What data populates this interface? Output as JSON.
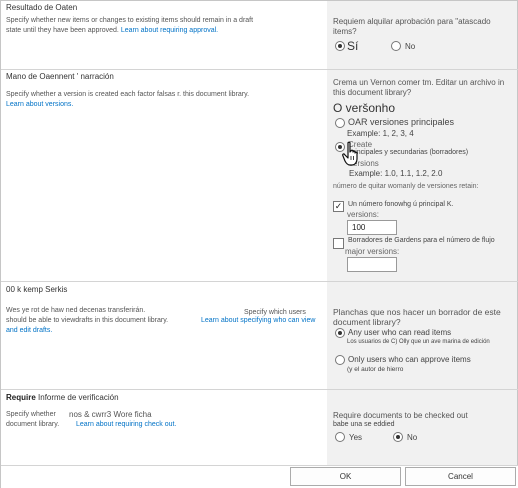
{
  "s1": {
    "title": "Resultado de Oaten",
    "desc": "Specify whether new items or changes to existing items should remain in a draft state until they have been approved.",
    "link": "Learn about requiring approval.",
    "question": "Requiem alquilar aprobación para \"atascado items?",
    "opt_yes": "Sí",
    "opt_no": "No"
  },
  "s2": {
    "title": "Mano de Oaennent ' narración",
    "desc": "Specify whether a version is created each factor falsas r.          this document library.",
    "link": "Learn about versions.",
    "question": "Crema un Vernon comer tm. Editar un archivo in this document library?",
    "heading": "O veršonho",
    "opt1": "OAR versiones principales",
    "opt1_example": "Example: 1, 2, 3, 4",
    "opt2_line1": "Create",
    "opt2_line2": "principales y secundarias (borradores)",
    "opt2_line3": "versions",
    "opt2_example": "Example: 1.0, 1.1, 1.2, 2.0",
    "limit_label": "número de quitar womanly de versiones retain:",
    "major_check_label": "Un número fonowhg ú principal K.",
    "major_check_label2": "versions:",
    "major_value": "100",
    "drafts_check_label": "Borradores de Gardens para el número de flujo",
    "drafts_check_label2": "major versions:"
  },
  "s3": {
    "title": "00 k kemp Serkis",
    "desc_line1": "Wes ye rot de haw ned decenas transferirán.",
    "desc_mid": "Specify which users",
    "desc_line2": "should be able to viewdrafts in this document library.",
    "link": "Learn about specifying who can view and edit drafts.",
    "question": "Planchas que nos hacer un borrador de este document library?",
    "opt1": "Any user who can read items",
    "opt1_sub": "Los usuarios de C) Olly que un ave marina de edición",
    "opt2": "Only users who can approve items",
    "opt2_sub": "(y el autor de hierro"
  },
  "s4": {
    "title_bold": "Require",
    "title_rest": "Informe de verificación",
    "desc_line1_a": "Specify whether",
    "desc_line1_b": "nos & cwrr3 Wore ficha",
    "desc_line2": "document library.",
    "link": "Learn about requiring check out.",
    "question": "Require documents to be checked out",
    "question2": "babe una se eddied",
    "opt_yes": "Yes",
    "opt_no": "No"
  },
  "buttons": {
    "ok": "OK",
    "cancel": "Cancel"
  },
  "colors": {
    "link": "#0072c6",
    "right_panel_bg": "#f1f1f1"
  },
  "icons": {
    "cursor": "hand-pointer-icon"
  }
}
